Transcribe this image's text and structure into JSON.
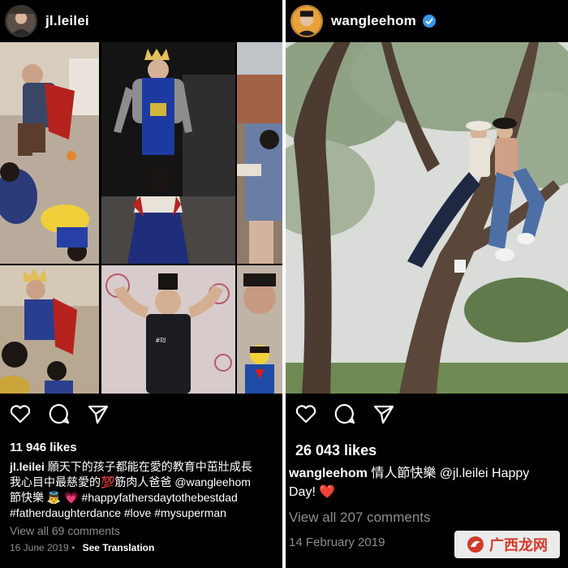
{
  "left_post": {
    "username": "jl.leilei",
    "likes": "11 946 likes",
    "caption": {
      "user": "jl.leilei",
      "line1": "願天下的孩子都能在愛的教育中茁壯成長",
      "line2": "我心目中最慈愛的💯筋肉人爸爸 @wangleehom",
      "line3": "節快樂 👼 💗 #happyfathersdaytothebestdad",
      "line4": "#fatherdaughterdance #love #mysuperman"
    },
    "comments": "View all 69 comments",
    "date": "16 June 2019",
    "see_translation": "See Translation"
  },
  "right_post": {
    "username": "wangleehom",
    "verified": true,
    "likes": "26 043 likes",
    "caption": {
      "user": "wangleehom",
      "line1_text": " 情人節快樂 @jl.leilei Happy",
      "line2_text": "Day! ❤️"
    },
    "comments": "View all 207 comments",
    "date": "14 February 2019"
  },
  "icons": {
    "like": "heart-icon",
    "comment": "comment-icon",
    "share": "share-icon",
    "verified": "verified-badge-icon"
  },
  "watermark": {
    "text": "广西龙网"
  },
  "colors": {
    "background": "#000000",
    "verified": "#3897f0",
    "muted_text": "#8e8e8e",
    "watermark_red": "#d23b2a"
  }
}
